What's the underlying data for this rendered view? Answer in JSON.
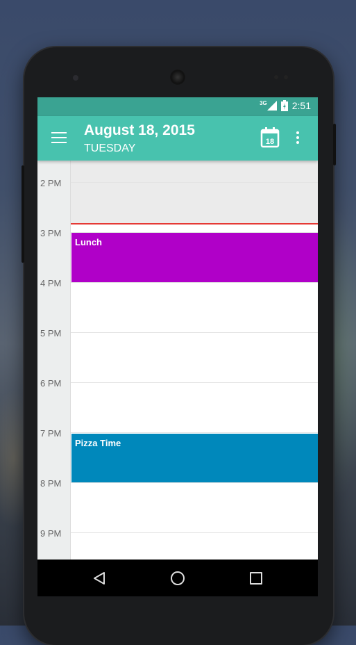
{
  "status_bar": {
    "network": "3G",
    "time": "2:51"
  },
  "app_bar": {
    "date": "August 18, 2015",
    "weekday": "TUESDAY",
    "calendar_day": "18"
  },
  "timeline": {
    "hours": [
      "2 PM",
      "3 PM",
      "4 PM",
      "5 PM",
      "6 PM",
      "7 PM",
      "8 PM",
      "9 PM"
    ],
    "events": [
      {
        "title": "Lunch",
        "color": "#b000c8"
      },
      {
        "title": "Pizza Time",
        "color": "#0088bb"
      }
    ],
    "now_indicator_color": "#e53935"
  },
  "fab": {
    "label": "+",
    "color": "#ff1f4b"
  },
  "colors": {
    "status_bar": "#3aa392",
    "app_bar": "#48c2ae"
  }
}
